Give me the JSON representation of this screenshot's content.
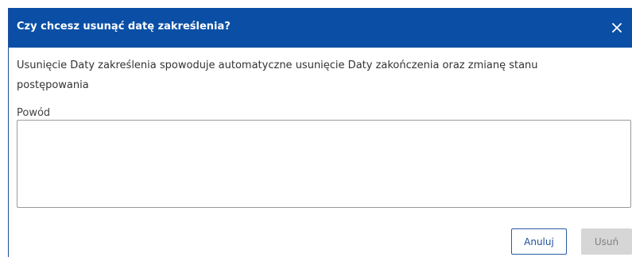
{
  "dialog": {
    "title": "Czy chcesz usunąć datę zakreślenia?",
    "message": "Usunięcie Daty zakreślenia spowoduje automatyczne usunięcie Daty zakończenia oraz zmianę stanu postępowania",
    "close_icon": "close-icon",
    "header_color": "#0a4fa5"
  },
  "form": {
    "reason_label": "Powód",
    "reason_value": "",
    "reason_placeholder": ""
  },
  "actions": {
    "cancel_label": "Anuluj",
    "delete_label": "Usuń",
    "delete_enabled": false
  }
}
